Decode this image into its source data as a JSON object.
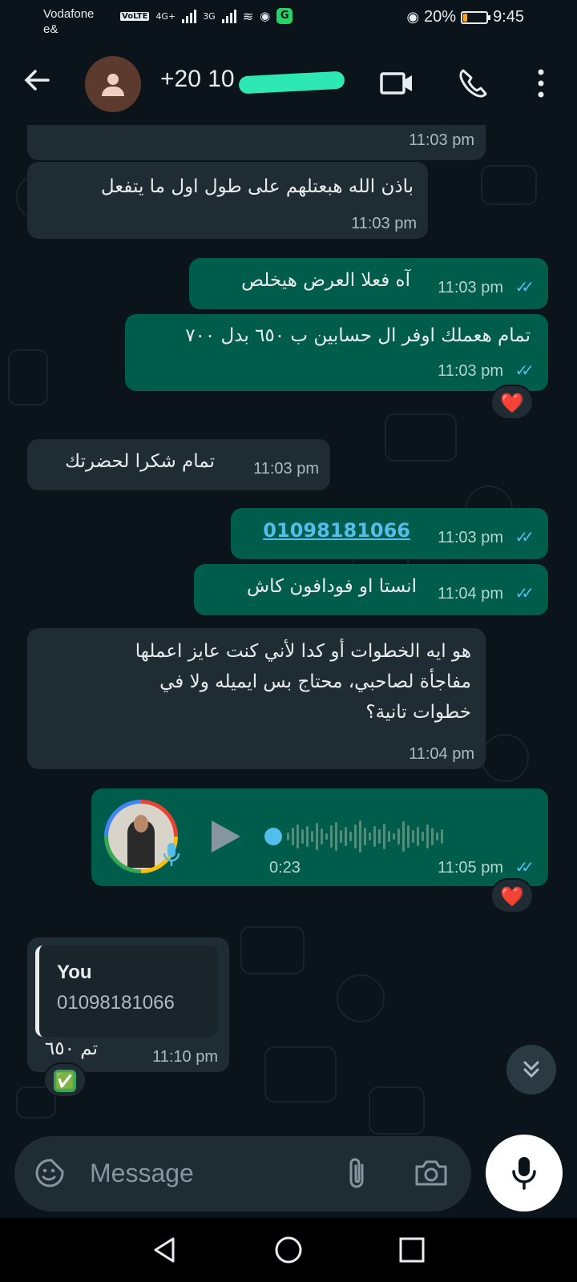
{
  "status_bar": {
    "carrier": "Vodafone",
    "carrier2": "e&",
    "volte": "VoLTE",
    "net1": "4G+",
    "net2": "3G",
    "battery_percent": "20%",
    "battery_level": 0.2,
    "time": "9:45",
    "icons": [
      "signal-icon",
      "wifi-icon",
      "hotspot-icon",
      "grammarly-icon",
      "eye-icon",
      "battery-icon"
    ]
  },
  "header": {
    "contact": "+20 10",
    "icons": [
      "back-arrow-icon",
      "video-call-icon",
      "voice-call-icon",
      "more-menu-icon"
    ]
  },
  "messages": [
    {
      "dir": "in",
      "text": "",
      "time": "11:03 pm"
    },
    {
      "dir": "in",
      "text": "باذن الله هبعتلهم على طول اول ما يتفعل",
      "time": "11:03 pm"
    },
    {
      "dir": "out",
      "text": "آه فعلا العرض هيخلص",
      "time": "11:03 pm"
    },
    {
      "dir": "out",
      "text": "تمام هعملك اوفر ال حسابين ب ٦٥٠ بدل ٧٠٠",
      "time": "11:03 pm",
      "reaction": "❤️"
    },
    {
      "dir": "in",
      "text": "تمام شكرا لحضرتك",
      "time": "11:03 pm"
    },
    {
      "dir": "out",
      "text": "01098181066",
      "time": "11:03 pm"
    },
    {
      "dir": "out",
      "text": "انستا او فودافون كاش",
      "time": "11:04 pm"
    },
    {
      "dir": "in",
      "lines": [
        "هو ايه الخطوات أو كدا لأني كنت عايز اعملها",
        "مفاجأة لصاحبي، محتاج بس ايميله ولا في",
        "خطوات تانية؟"
      ],
      "time": "11:04 pm"
    },
    {
      "dir": "out",
      "type": "voice",
      "duration": "0:23",
      "time": "11:05 pm",
      "reaction": "❤️"
    },
    {
      "dir": "in",
      "quote_name": "You",
      "quote_text": "01098181066",
      "text": "تم ٦٥٠",
      "time": "11:10 pm",
      "reaction": "✅"
    }
  ],
  "input": {
    "placeholder": "Message",
    "icons": [
      "emoji-sticker-icon",
      "attach-icon",
      "camera-icon",
      "microphone-icon"
    ]
  },
  "nav_icons": [
    "nav-back-icon",
    "nav-home-icon",
    "nav-recents-icon"
  ],
  "colors": {
    "incoming": "#202c33",
    "outgoing": "#005c4b",
    "tick": "#53bdeb",
    "background": "#0b141a"
  }
}
